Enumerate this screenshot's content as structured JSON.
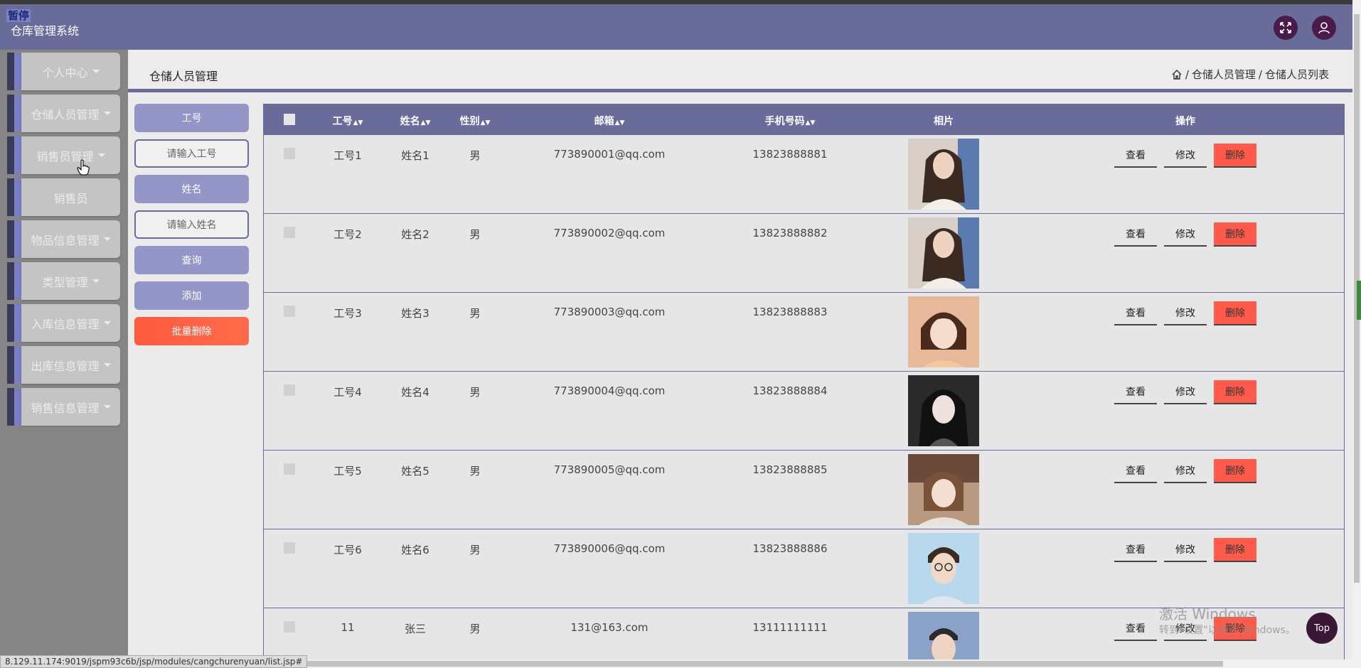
{
  "header": {
    "badge": "暂停",
    "app_title": "仓库管理系统"
  },
  "sidebar": {
    "items": [
      {
        "label": "个人中心",
        "caret": true
      },
      {
        "label": "仓储人员管理",
        "caret": true
      },
      {
        "label": "销售员管理",
        "caret": true
      },
      {
        "label": "销售员",
        "caret": false
      },
      {
        "label": "物品信息管理",
        "caret": true
      },
      {
        "label": "类型管理",
        "caret": true
      },
      {
        "label": "入库信息管理",
        "caret": true
      },
      {
        "label": "出库信息管理",
        "caret": true
      },
      {
        "label": "销售信息管理",
        "caret": true
      }
    ]
  },
  "page": {
    "title": "仓储人员管理",
    "breadcrumb": [
      "仓储人员管理",
      "仓储人员列表"
    ],
    "breadcrumb_sep": "/"
  },
  "filters": {
    "emp_no_label": "工号",
    "emp_no_placeholder": "请输入工号",
    "name_label": "姓名",
    "name_placeholder": "请输入姓名",
    "search_button": "查询",
    "add_button": "添加",
    "batch_delete_button": "批量删除"
  },
  "table": {
    "columns": [
      "工号",
      "姓名",
      "性别",
      "邮箱",
      "手机号码",
      "相片",
      "操作"
    ],
    "actions": {
      "view": "查看",
      "edit": "修改",
      "delete": "删除"
    },
    "rows": [
      {
        "emp_no": "工号1",
        "name": "姓名1",
        "gender": "男",
        "email": "773890001@qq.com",
        "phone": "13823888881",
        "photo": "woman-long-hair"
      },
      {
        "emp_no": "工号2",
        "name": "姓名2",
        "gender": "男",
        "email": "773890002@qq.com",
        "phone": "13823888882",
        "photo": "woman-long-hair"
      },
      {
        "emp_no": "工号3",
        "name": "姓名3",
        "gender": "男",
        "email": "773890003@qq.com",
        "phone": "13823888883",
        "photo": "woman-bob-hair"
      },
      {
        "emp_no": "工号4",
        "name": "姓名4",
        "gender": "男",
        "email": "773890004@qq.com",
        "phone": "13823888884",
        "photo": "woman-dark-hair"
      },
      {
        "emp_no": "工号5",
        "name": "姓名5",
        "gender": "男",
        "email": "773890005@qq.com",
        "phone": "13823888885",
        "photo": "woman-smiling"
      },
      {
        "emp_no": "工号6",
        "name": "姓名6",
        "gender": "男",
        "email": "773890006@qq.com",
        "phone": "13823888886",
        "photo": "man-glasses"
      },
      {
        "emp_no": "11",
        "name": "张三",
        "gender": "男",
        "email": "131@163.com",
        "phone": "13111111111",
        "photo": "man-short-hair"
      }
    ]
  },
  "watermark": {
    "line1": "激活 Windows",
    "line2": "转到\"设置\"以激活 Windows。"
  },
  "top_button": "Top",
  "status_url": "8.129.11.174:9019/jspm93c6b/jsp/modules/cangchurenyuan/list.jsp#",
  "colors": {
    "primary": "#696c99",
    "accent_light": "#9496c7",
    "danger": "#ff5a4a",
    "dark_button": "#4a1a4a"
  }
}
